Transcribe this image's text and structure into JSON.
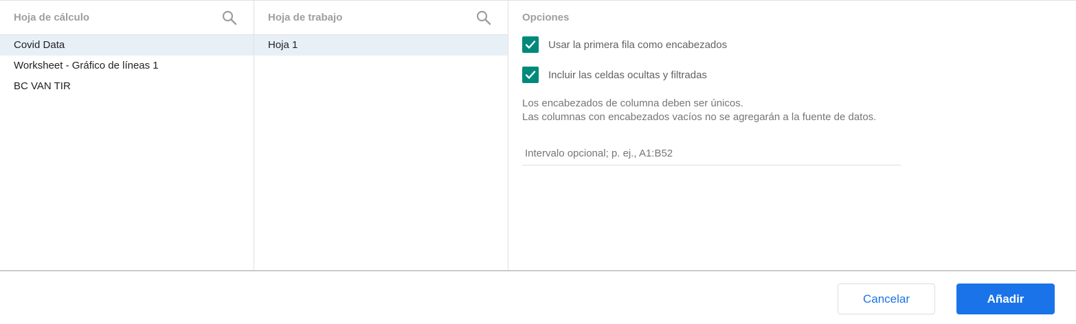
{
  "sheets_panel": {
    "title": "Hoja de cálculo",
    "search_icon": "search-icon",
    "items": [
      {
        "label": "Covid Data",
        "selected": true
      },
      {
        "label": "Worksheet - Gráfico de líneas 1",
        "selected": false
      },
      {
        "label": "BC VAN TIR",
        "selected": false
      }
    ]
  },
  "worksheets_panel": {
    "title": "Hoja de trabajo",
    "search_icon": "search-icon",
    "items": [
      {
        "label": "Hoja 1",
        "selected": true
      }
    ]
  },
  "options_panel": {
    "title": "Opciones",
    "checkboxes": [
      {
        "label": "Usar la primera fila como encabezados",
        "checked": true
      },
      {
        "label": "Incluir las celdas ocultas y filtradas",
        "checked": true
      }
    ],
    "note_line1": "Los encabezados de columna deben ser únicos.",
    "note_line2": "Las columnas con encabezados vacíos no se agregarán a la fuente de datos.",
    "range_input": {
      "value": "",
      "placeholder": "Intervalo opcional; p. ej., A1:B52"
    }
  },
  "footer": {
    "cancel_label": "Cancelar",
    "add_label": "Añadir"
  },
  "colors": {
    "accent": "#1a73e8",
    "checkbox": "#00897b",
    "selected_row": "#e8f0f7"
  }
}
